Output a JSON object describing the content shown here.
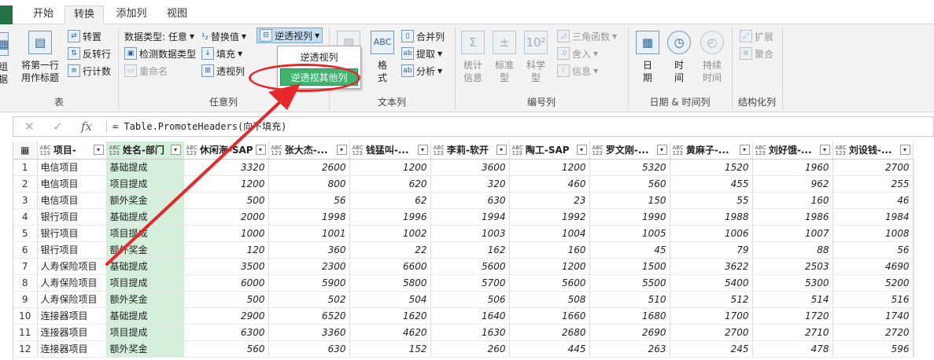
{
  "tabs": {
    "home": "开始",
    "transform": "转换",
    "add_column": "添加列",
    "view": "视图"
  },
  "ribbon": {
    "table_group": {
      "label": "表",
      "group_by_cut": "组\n据",
      "use_first_row": "将第一行",
      "use_first_row_2": "用作标题",
      "transpose": "转置",
      "reverse_rows": "反转行",
      "count_rows": "行计数"
    },
    "any_column_group": {
      "label": "任意列",
      "data_type": "数据类型: 任意",
      "detect_type": "检测数据类型",
      "rename": "重命名",
      "replace_values": "替换值",
      "fill": "填充",
      "pivot_column": "透视列",
      "unpivot_columns": "逆透视列",
      "unpivot_menu": {
        "item1": "逆透视列",
        "item2": "逆透视其他列"
      }
    },
    "text_column_group": {
      "label": "文本列",
      "split_column_cut": "格",
      "format_cut": "式",
      "merge_columns": "合并列",
      "extract": "提取",
      "parse": "分析"
    },
    "number_column_group": {
      "label": "编号列",
      "statistics": "统计",
      "statistics_2": "信息",
      "standard": "标准",
      "standard_2": "型",
      "scientific": "科学",
      "scientific_2": "型",
      "trigonometry": "三角函数",
      "rounding": "舍入",
      "information": "信息"
    },
    "datetime_group": {
      "label": "日期 & 时间列",
      "date": "日",
      "date_2": "期",
      "time": "时",
      "time_2": "间",
      "duration": "持续",
      "duration_2": "时间"
    },
    "structured_group": {
      "label": "结构化列",
      "expand": "扩展",
      "aggregate": "聚合"
    }
  },
  "formula_bar": {
    "fx": "fx",
    "formula": "= Table.PromoteHeaders(向下填充)"
  },
  "table": {
    "type_badge": "ABC\n123",
    "columns": [
      "项目-",
      "姓名-部门",
      "休闲海-SAP",
      "张大杰-...",
      "钱猛叫-...",
      "李莉-软开",
      "陶工-SAP",
      "罗文刚-...",
      "黄麻子-...",
      "刘好饿-...",
      "刘设钱-..."
    ],
    "rows": [
      {
        "n": "1",
        "project": "电信项目",
        "name": "基础提成",
        "vals": [
          "3320",
          "2600",
          "1200",
          "3600",
          "1200",
          "5320",
          "1520",
          "1960",
          "2700"
        ]
      },
      {
        "n": "2",
        "project": "电信项目",
        "name": "项目提成",
        "vals": [
          "1200",
          "800",
          "620",
          "320",
          "460",
          "560",
          "455",
          "962",
          "255"
        ]
      },
      {
        "n": "3",
        "project": "电信项目",
        "name": "额外奖金",
        "vals": [
          "500",
          "56",
          "62",
          "630",
          "23",
          "150",
          "55",
          "160",
          "46"
        ]
      },
      {
        "n": "4",
        "project": "银行项目",
        "name": "基础提成",
        "vals": [
          "2000",
          "1998",
          "1996",
          "1994",
          "1992",
          "1990",
          "1988",
          "1986",
          "1984"
        ]
      },
      {
        "n": "5",
        "project": "银行项目",
        "name": "项目提成",
        "vals": [
          "1000",
          "1001",
          "1002",
          "1003",
          "1004",
          "1005",
          "1006",
          "1007",
          "1008"
        ]
      },
      {
        "n": "6",
        "project": "银行项目",
        "name": "额外奖金",
        "vals": [
          "120",
          "360",
          "22",
          "162",
          "160",
          "45",
          "79",
          "88",
          "56"
        ]
      },
      {
        "n": "7",
        "project": "人寿保险项目",
        "name": "基础提成",
        "vals": [
          "3500",
          "2300",
          "6600",
          "5600",
          "1200",
          "1500",
          "3622",
          "2503",
          "4690"
        ]
      },
      {
        "n": "8",
        "project": "人寿保险项目",
        "name": "项目提成",
        "vals": [
          "6000",
          "5900",
          "5800",
          "5700",
          "5600",
          "5500",
          "5400",
          "5300",
          "5200"
        ]
      },
      {
        "n": "9",
        "project": "人寿保险项目",
        "name": "额外奖金",
        "vals": [
          "500",
          "502",
          "504",
          "506",
          "508",
          "510",
          "512",
          "514",
          "516"
        ]
      },
      {
        "n": "10",
        "project": "连接器项目",
        "name": "基础提成",
        "vals": [
          "2900",
          "6520",
          "1620",
          "1640",
          "1660",
          "1680",
          "1700",
          "1720",
          "1740"
        ]
      },
      {
        "n": "11",
        "project": "连接器项目",
        "name": "项目提成",
        "vals": [
          "6300",
          "3360",
          "4620",
          "1630",
          "2680",
          "2690",
          "2700",
          "2710",
          "2720"
        ]
      },
      {
        "n": "12",
        "project": "连接器项目",
        "name": "额外奖金",
        "vals": [
          "560",
          "630",
          "152",
          "260",
          "445",
          "263",
          "245",
          "478",
          "596"
        ]
      }
    ]
  },
  "colors": {
    "selected_column": "#d5efdd",
    "annotation_red": "#e8262b",
    "menu_highlight": "#3fb46f"
  }
}
